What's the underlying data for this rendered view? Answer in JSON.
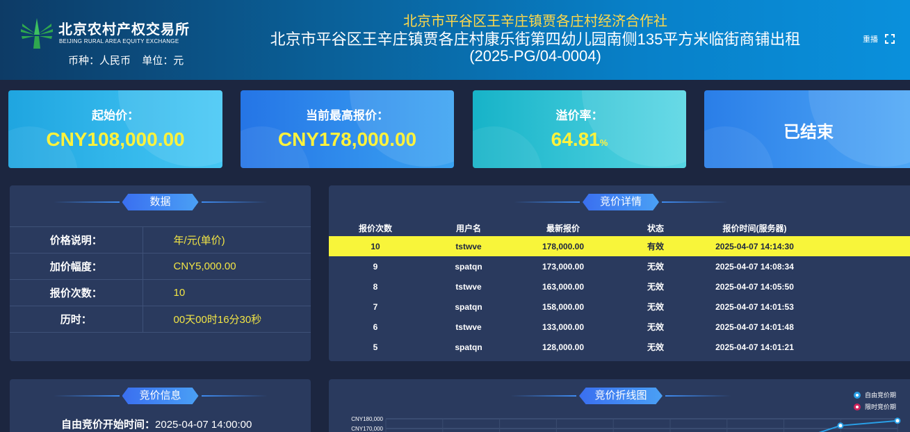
{
  "header": {
    "logo_cn": "北京农村产权交易所",
    "logo_en": "BEIJING RURAL AREA EQUITY EXCHANGE",
    "currency_label": "币种：人民币",
    "unit_label": "单位：元",
    "org": "北京市平谷区王辛庄镇贾各庄村经济合作社",
    "title": "北京市平谷区王辛庄镇贾各庄村康乐街第四幼儿园南侧135平方米临街商铺出租",
    "code": "(2025-PG/04-0004)",
    "replay": "重播"
  },
  "cards": {
    "start_label": "起始价：",
    "start_value": "CNY108,000.00",
    "highest_label": "当前最高报价：",
    "highest_value": "CNY178,000.00",
    "premium_label": "溢价率：",
    "premium_value": "64.81",
    "premium_unit": "%",
    "status": "已结束"
  },
  "data_panel": {
    "title": "数据",
    "rows": [
      {
        "k": "价格说明：",
        "v": "年/元(单价)"
      },
      {
        "k": "加价幅度：",
        "v": "CNY5,000.00"
      },
      {
        "k": "报价次数：",
        "v": "10"
      },
      {
        "k": "历时：",
        "v": "00天00时16分30秒"
      }
    ]
  },
  "detail_panel": {
    "title": "竞价详情",
    "headers": [
      "报价次数",
      "用户名",
      "最新报价",
      "状态",
      "报价时间(服务器)"
    ],
    "rows": [
      [
        "10",
        "tstwve",
        "178,000.00",
        "有效",
        "2025-04-07 14:14:30"
      ],
      [
        "9",
        "spatqn",
        "173,000.00",
        "无效",
        "2025-04-07 14:08:34"
      ],
      [
        "8",
        "tstwve",
        "163,000.00",
        "无效",
        "2025-04-07 14:05:50"
      ],
      [
        "7",
        "spatqn",
        "158,000.00",
        "无效",
        "2025-04-07 14:01:53"
      ],
      [
        "6",
        "tstwve",
        "133,000.00",
        "无效",
        "2025-04-07 14:01:48"
      ],
      [
        "5",
        "spatqn",
        "128,000.00",
        "无效",
        "2025-04-07 14:01:21"
      ]
    ]
  },
  "info_panel": {
    "title": "竞价信息",
    "start_label": "自由竞价开始时间：",
    "start_value": "2025-04-07 14:00:00"
  },
  "chart_panel": {
    "title": "竞价折线图",
    "legend": [
      "自由竞价期",
      "限时竞价期"
    ]
  },
  "chart_data": {
    "type": "line",
    "ytick_labels": [
      "CNY180,000",
      "CNY170,000"
    ],
    "series": [
      {
        "name": "自由竞价期",
        "values": [
          173000,
          178000
        ]
      }
    ],
    "colors": {
      "free": "#29a0e8",
      "limited": "#d0245c"
    },
    "grid": true,
    "legend_position": "top-right"
  }
}
